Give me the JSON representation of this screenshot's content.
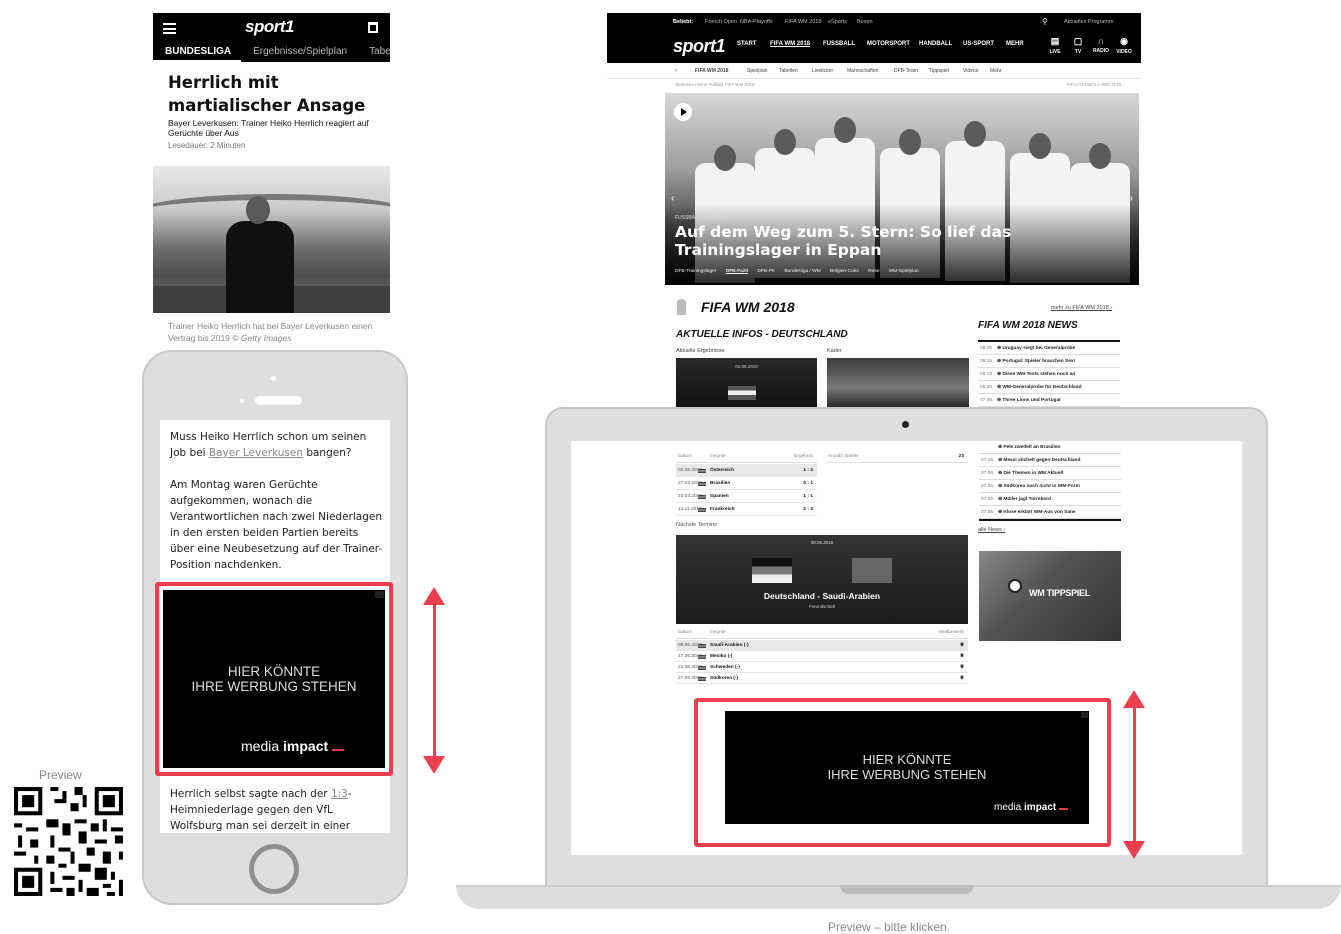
{
  "mobile_article": {
    "logo": "sport1",
    "tabs": [
      "BUNDESLIGA",
      "Ergebnisse/Spielplan",
      "Tabelle"
    ],
    "title": "Herrlich mit martialischer Ansage",
    "subtitle": "Bayer Leverkusen: Trainer Heiko Herrlich reagiert auf Gerüchte über Aus",
    "read_time": "Lesedauer: 2 Minuten",
    "caption_text": "Trainer Heiko Herrlich hat bei Bayer Leverkusen einen Vertrag bis 2019 ©",
    "caption_credit": "Getty Images"
  },
  "phone_article": {
    "para1_a": "Muss Heiko Herrlich schon um seinen Job bei ",
    "para1_link": "Bayer Leverkusen",
    "para1_b": " bangen?",
    "para2": "Am Montag waren Gerüchte aufgekommen, wonach die Verantwortlichen nach zwei Niederlagen in den ersten beiden Partien bereits über eine Neubesetzung auf der Trainer-Position nachdenken.",
    "para3_a": "Herrlich selbst sagte nach der ",
    "para3_link": "1:3",
    "para3_b": "-Heimniederlage gegen den VfL Wolfsburg man sei derzeit in einer \"schwierigen"
  },
  "ad": {
    "line1": "HIER KÖNNTE",
    "line2": "IHRE WERBUNG STEHEN",
    "brand_light": "media",
    "brand_bold": "impact"
  },
  "desktop": {
    "topbar": {
      "beliebt": "Beliebt:",
      "links": [
        "French Open",
        "NBA-Playoffs",
        "FIFA WM 2018",
        "eSports",
        "Boxen"
      ],
      "programm": "Aktuelles Programm"
    },
    "logo": "sport1",
    "nav": [
      "START",
      "FIFA WM 2018",
      "FUSSBALL",
      "MOTORSPORT",
      "HANDBALL",
      "US-SPORT",
      "MEHR"
    ],
    "nav_icons": [
      "LIVE",
      "TV",
      "RADIO",
      "VIDEO"
    ],
    "subnav": [
      "FIFA WM 2018",
      "Spielplan",
      "Tabellen",
      "Liveticker",
      "Mannschaften",
      "DFB-Team",
      "Tippspiel",
      "Videos",
      "Mehr"
    ],
    "breadcrumb": "Startseite  Home  Fußball  FIFA WM 2018",
    "breadcrumb_right": "FIFA FUSSBALL-WM 2018",
    "hero_kicker": "FUSSBALL / WM 2018",
    "hero_title": "Auf dem Weg zum 5. Stern: So lief das Trainingslager in Eppan",
    "hero_tags": [
      "DFB-Trainingslager",
      "DFB-Fazit",
      "DFB-PK",
      "Bundesliga / WM",
      "Belgien-Coko",
      "Rose",
      "WM-Spielplan"
    ],
    "section_title": "FIFA WM 2018",
    "section_more": "mehr zu FIFA WM 2018",
    "infos_title": "AKTUELLE INFOS - DEUTSCHLAND",
    "news_title": "FIFA WM 2018 NEWS",
    "ergebnisse_label": "Aktuelle Ergebnisse",
    "kader_label": "Kader",
    "match_date": "02.06.2018",
    "news": [
      {
        "t": "08:26",
        "n": "Uruguay siegt bei Generalprobe"
      },
      {
        "t": "08:15",
        "n": "Portugal: Spieler brauchen Sex!"
      },
      {
        "t": "06:19",
        "n": "Diese WM-Tests stehen noch an"
      },
      {
        "t": "05:40",
        "n": "WM-Generalprobe für Deutschland"
      },
      {
        "t": "07.06.",
        "n": "Three Lions und Portugal"
      }
    ]
  },
  "laptop": {
    "news": [
      {
        "t": "",
        "n": "Pele zweifelt an Brasilien"
      },
      {
        "t": "07.06.",
        "n": "Messi stichelt gegen Deutschland"
      },
      {
        "t": "07.06.",
        "n": "Die Themen in WM Aktuell"
      },
      {
        "t": "07.06.",
        "n": "Südkorea noch nicht in WM-Form"
      },
      {
        "t": "07.06.",
        "n": "Müller jagt Torrekord"
      },
      {
        "t": "07.06.",
        "n": "Klose erklärt WM-Aus von Sane"
      }
    ],
    "alle_news": "alle News",
    "promo": "WM TIPPSPIEL",
    "results_header": [
      "Datum",
      "Gegner",
      "Ergebnis"
    ],
    "anzahl": [
      "Anzahl Spieler",
      "23"
    ],
    "results": [
      {
        "d": "02.06.2018",
        "g": "Österreich",
        "e": "1 : 2"
      },
      {
        "d": "27.03.2018",
        "g": "Brasilien",
        "e": "0 : 1"
      },
      {
        "d": "23.03.2018",
        "g": "Spanien",
        "e": "1 : 1"
      },
      {
        "d": "14.11.2017",
        "g": "Frankreich",
        "e": "2 : 2"
      }
    ],
    "next_label": "Nächste Termine",
    "next_date": "08.06.2018",
    "next_match": "Deutschland - Saudi-Arabien",
    "next_type": "Freundschaft",
    "fixtures_header": [
      "Datum",
      "Gegner",
      "Wettbewerb"
    ],
    "fixtures": [
      {
        "d": "08.06.2018",
        "g": "Saudi-Arabien (-)"
      },
      {
        "d": "17.06.2018",
        "g": "Mexiko (-)"
      },
      {
        "d": "23.06.2018",
        "g": "Schweden (-)"
      },
      {
        "d": "27.06.2018",
        "g": "Südkorea (-)"
      }
    ]
  },
  "qr_label": "Preview",
  "caption": "Preview – bitte klicken."
}
